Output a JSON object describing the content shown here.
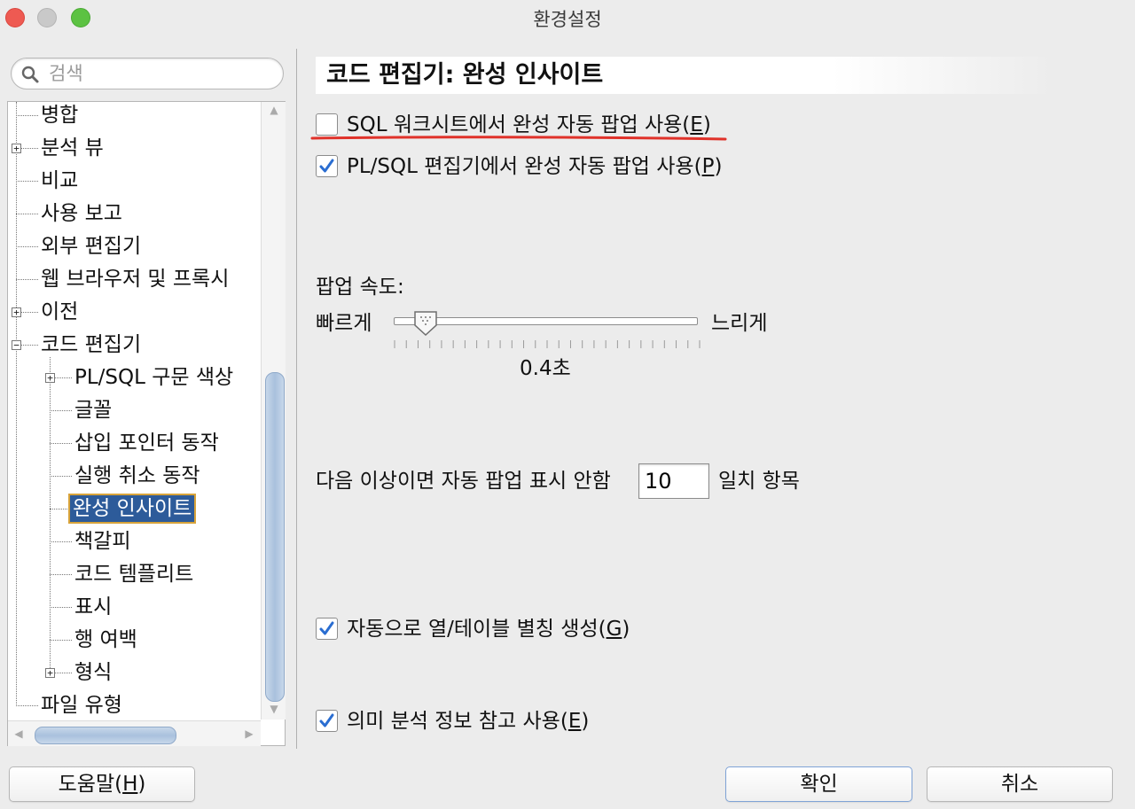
{
  "window": {
    "title": "환경설정"
  },
  "search": {
    "placeholder": "검색"
  },
  "tree": {
    "items": [
      {
        "label": "병합"
      },
      {
        "label": "분석 뷰"
      },
      {
        "label": "비교"
      },
      {
        "label": "사용 보고"
      },
      {
        "label": "외부 편집기"
      },
      {
        "label": "웹 브라우저 및 프록시"
      },
      {
        "label": "이전"
      },
      {
        "label": "코드 편집기"
      },
      {
        "label": "PL/SQL 구문 색상"
      },
      {
        "label": "글꼴"
      },
      {
        "label": "삽입 포인터 동작"
      },
      {
        "label": "실행 취소 동작"
      },
      {
        "label": "완성 인사이트"
      },
      {
        "label": "책갈피"
      },
      {
        "label": "코드 템플리트"
      },
      {
        "label": "표시"
      },
      {
        "label": "행 여백"
      },
      {
        "label": "형식"
      },
      {
        "label": "파일 유형"
      }
    ],
    "selected": "완성 인사이트"
  },
  "panel": {
    "title": "코드 편집기: 완성 인사이트",
    "options": {
      "sql_worksheet": {
        "label": "SQL 워크시트에서 완성 자동 팝업 사용(",
        "mnemonic": "E",
        "close": ")",
        "checked": false
      },
      "plsql_editor": {
        "label": "PL/SQL 편집기에서 완성 자동 팝업 사용(",
        "mnemonic": "P",
        "close": ")",
        "checked": true
      },
      "column_alias": {
        "label": "자동으로 열/테이블 별칭 생성(",
        "mnemonic": "G",
        "close": ")",
        "checked": true
      },
      "semantic": {
        "label": "의미 분석 정보 참고 사용(",
        "mnemonic": "E",
        "close": ")",
        "checked": true
      }
    },
    "popup_speed": {
      "label": "팝업 속도:",
      "fast_label": "빠르게",
      "slow_label": "느리게",
      "value_text": "0.4초",
      "position_fraction": 0.1
    },
    "threshold": {
      "prefix": "다음 이상이면 자동 팝업 표시 안함",
      "value": "10",
      "suffix": "일치 항목"
    }
  },
  "buttons": {
    "help": {
      "label": "도움말(",
      "mnemonic": "H",
      "close": ")"
    },
    "ok": "확인",
    "cancel": "취소"
  },
  "colors": {
    "selection": "#2d5b9a",
    "annotation": "#e0322a"
  }
}
